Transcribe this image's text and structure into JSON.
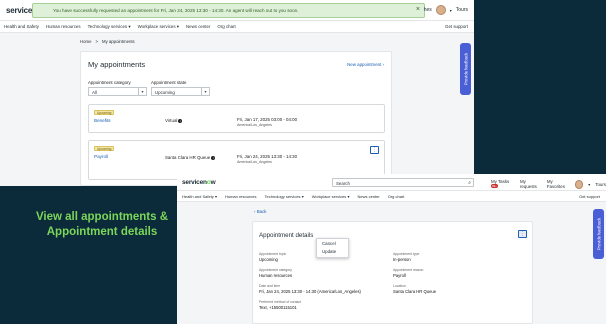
{
  "window1": {
    "logo": {
      "prefix": "servicen",
      "o": "o",
      "suffix": "w"
    },
    "toast": {
      "message": "You have successfully requested an appointment for Fri, Jan 24, 2025 13:30 - 14:30. An agent will reach out to you soon.",
      "close": "×"
    },
    "header_right": {
      "partial": "hes",
      "user": "Tours"
    },
    "nav": {
      "items": [
        "Health and Safety",
        "Human resources",
        "Technology services",
        "Workplace services",
        "News center",
        "Org chart"
      ],
      "support": "Get support"
    },
    "breadcrumb": {
      "home": "Home",
      "sep": ">",
      "current": "My appointments"
    },
    "title": "My appointments",
    "new_appointment": "New appointment",
    "filters": {
      "category_label": "Appointment category",
      "category_value": "All",
      "state_label": "Appointment state",
      "state_value": "Upcoming"
    },
    "appointments": [
      {
        "badge": "Upcoming",
        "name": "Benefits",
        "location": "Virtual",
        "datetime": "Fri, Jan 17, 2025 03:00 - 04:00",
        "timezone": "America/Los_Angeles"
      },
      {
        "badge": "Upcoming",
        "name": "Payroll",
        "location": "Santa Clara HR Queue",
        "datetime": "Fri, Jan 24, 2025 13:30 - 14:30",
        "timezone": "America/Los_Angeles"
      }
    ],
    "feedback": "Provide feedback"
  },
  "caption": {
    "line1": "View all appointments &",
    "line2": "Appointment details"
  },
  "window2": {
    "logo": {
      "prefix": "servicen",
      "o": "o",
      "suffix": "w"
    },
    "search_placeholder": "Search",
    "header_right": {
      "tasks": "My Tasks",
      "tasks_badge": "99+",
      "requests": "My requests",
      "favorites": "My Favorites",
      "user": "Tours"
    },
    "nav": {
      "items": [
        "Health and Safety",
        "Human resources",
        "Technology services",
        "Workplace services",
        "News center",
        "Org chart"
      ],
      "support": "Get support"
    },
    "back": "Back",
    "title": "Appointment details",
    "fields": {
      "appointment_topic_label": "Appointment topic",
      "appointment_topic": "Upcoming",
      "appointment_type_label": "Appointment type",
      "appointment_type": "In-person",
      "appointment_category_label": "Appointment category",
      "appointment_category": "Human resources",
      "appointment_reason_label": "Appointment reason",
      "appointment_reason": "Payroll",
      "date_time_label": "Date and time",
      "date_time": "Fri, Jan 24, 2025 13:30 - 14:30 (America/Los_Angeles)",
      "location_label": "Location",
      "location": "Santa Clara HR Queue",
      "contact_label": "Preferred method of contact",
      "contact": "Text, +15500115101"
    },
    "menu": {
      "cancel": "Cancel",
      "update": "Update"
    },
    "feedback": "Provide feedback"
  }
}
